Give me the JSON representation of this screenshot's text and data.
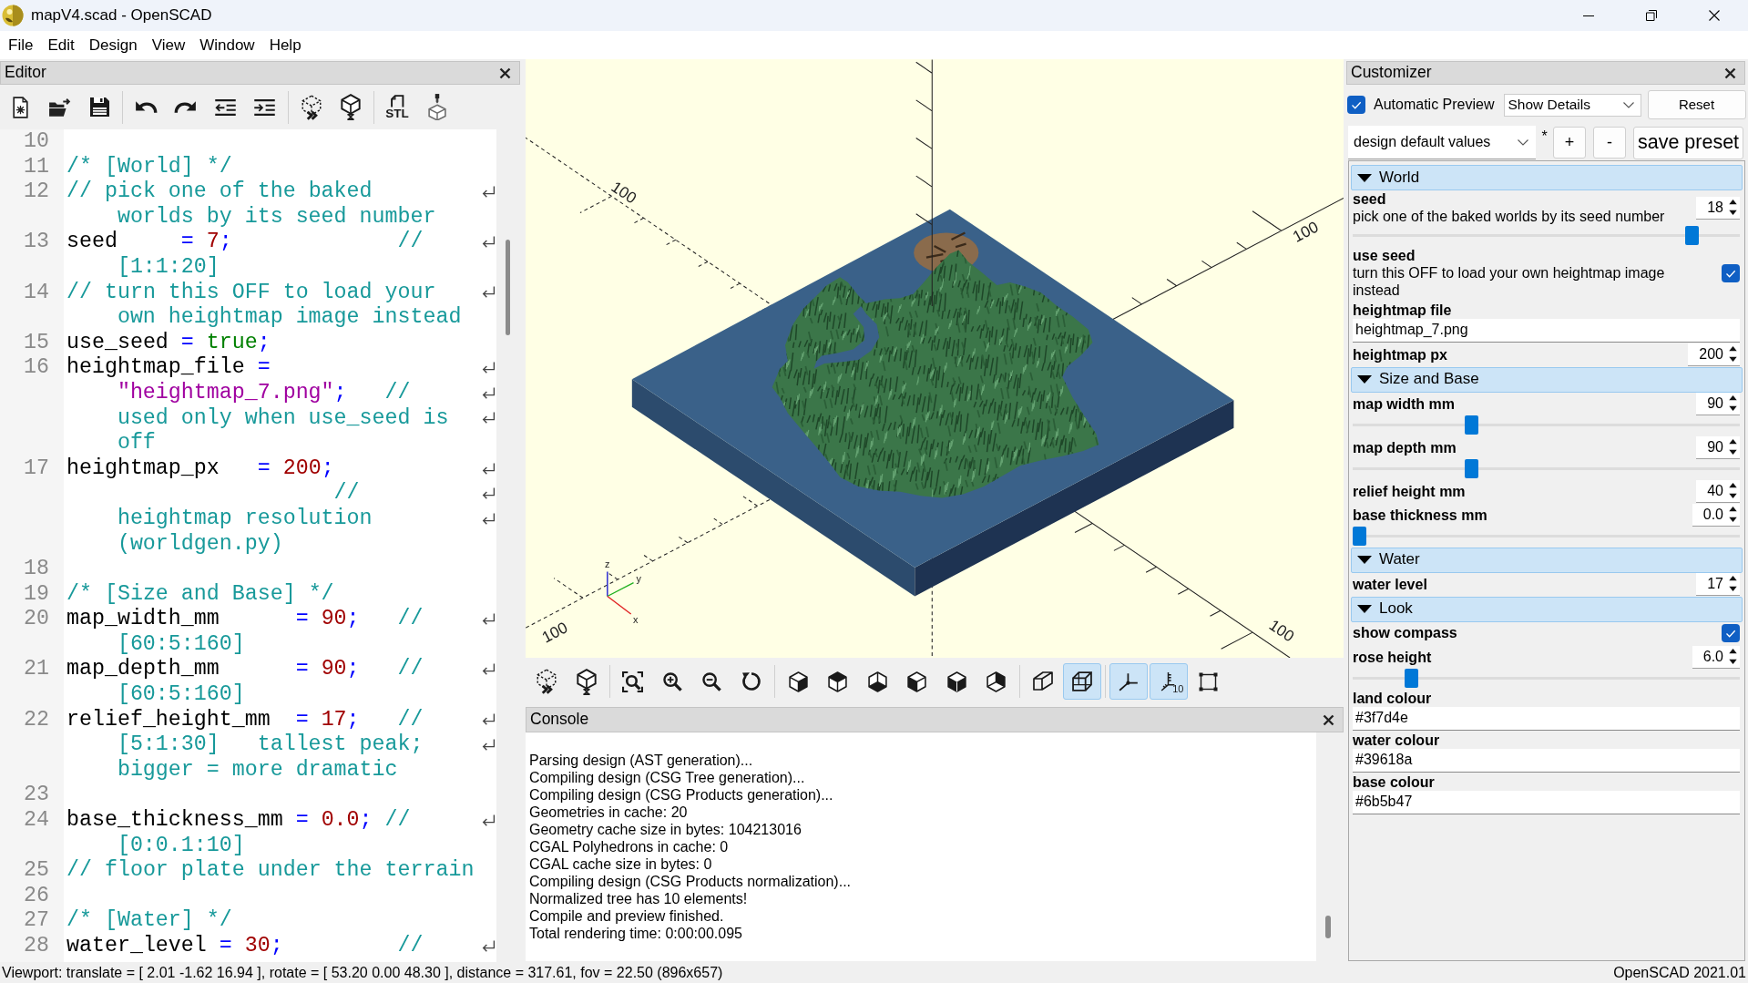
{
  "window": {
    "title": "mapV4.scad - OpenSCAD"
  },
  "menu": [
    "File",
    "Edit",
    "Design",
    "View",
    "Window",
    "Help"
  ],
  "editor": {
    "title": "Editor",
    "export_label": "STL",
    "lines": [
      {
        "number": "10"
      },
      {
        "number": "11",
        "display_lines": [
          {
            "spans": [
              {
                "kind": "comment",
                "text": "/* [World] */"
              }
            ]
          }
        ]
      },
      {
        "number": "12",
        "display_lines": [
          {
            "spans": [
              {
                "kind": "comment",
                "text": "// pick one of the baked"
              }
            ]
          },
          {
            "spans": [
              {
                "kind": "comment",
                "text": "worlds by its seed number"
              }
            ]
          }
        ]
      },
      {
        "number": "13",
        "display_lines": [
          {
            "spans": [
              {
                "kind": "name",
                "text": "seed     "
              },
              {
                "kind": "op",
                "text": "= "
              },
              {
                "kind": "number",
                "text": "7"
              },
              {
                "kind": "op",
                "text": ";"
              },
              {
                "kind": "comment",
                "text": "             //"
              }
            ]
          },
          {
            "spans": [
              {
                "kind": "comment",
                "text": "[1:1:20]"
              }
            ]
          }
        ]
      },
      {
        "number": "14",
        "display_lines": [
          {
            "spans": [
              {
                "kind": "comment",
                "text": "// turn this OFF to load your"
              }
            ]
          },
          {
            "spans": [
              {
                "kind": "comment",
                "text": "own heightmap image instead"
              }
            ]
          }
        ]
      },
      {
        "number": "15",
        "display_lines": [
          {
            "spans": [
              {
                "kind": "name",
                "text": "use_seed "
              },
              {
                "kind": "op",
                "text": "= "
              },
              {
                "kind": "keyword",
                "text": "true"
              },
              {
                "kind": "op",
                "text": ";"
              }
            ]
          }
        ]
      },
      {
        "number": "16",
        "display_lines": [
          {
            "spans": [
              {
                "kind": "name",
                "text": "heightmap_file "
              },
              {
                "kind": "op",
                "text": "="
              }
            ]
          },
          {
            "spans": [
              {
                "kind": "string",
                "text": "\"heightmap_7.png\""
              },
              {
                "kind": "op",
                "text": ";"
              },
              {
                "kind": "comment",
                "text": "   //"
              }
            ]
          },
          {
            "spans": [
              {
                "kind": "comment",
                "text": "used only when use_seed is"
              }
            ]
          },
          {
            "spans": [
              {
                "kind": "comment",
                "text": "off"
              }
            ]
          }
        ]
      },
      {
        "number": "17",
        "display_lines": [
          {
            "spans": [
              {
                "kind": "name",
                "text": "heightmap_px   "
              },
              {
                "kind": "op",
                "text": "= "
              },
              {
                "kind": "number",
                "text": "200"
              },
              {
                "kind": "op",
                "text": ";"
              }
            ]
          },
          {
            "spans": [
              {
                "kind": "comment",
                "text": "                 //"
              }
            ]
          },
          {
            "spans": [
              {
                "kind": "comment",
                "text": "heightmap resolution"
              }
            ]
          },
          {
            "spans": [
              {
                "kind": "comment",
                "text": "(worldgen.py)"
              }
            ]
          }
        ]
      },
      {
        "number": "18"
      },
      {
        "number": "19",
        "display_lines": [
          {
            "spans": [
              {
                "kind": "comment",
                "text": "/* [Size and Base] */"
              }
            ]
          }
        ]
      },
      {
        "number": "20",
        "display_lines": [
          {
            "spans": [
              {
                "kind": "name",
                "text": "map_width_mm      "
              },
              {
                "kind": "op",
                "text": "= "
              },
              {
                "kind": "number",
                "text": "90"
              },
              {
                "kind": "op",
                "text": ";"
              },
              {
                "kind": "comment",
                "text": "   //"
              }
            ]
          },
          {
            "spans": [
              {
                "kind": "comment",
                "text": "[60:5:160]"
              }
            ]
          }
        ]
      },
      {
        "number": "21",
        "display_lines": [
          {
            "spans": [
              {
                "kind": "name",
                "text": "map_depth_mm      "
              },
              {
                "kind": "op",
                "text": "= "
              },
              {
                "kind": "number",
                "text": "90"
              },
              {
                "kind": "op",
                "text": ";"
              },
              {
                "kind": "comment",
                "text": "   //"
              }
            ]
          },
          {
            "spans": [
              {
                "kind": "comment",
                "text": "[60:5:160]"
              }
            ]
          }
        ]
      },
      {
        "number": "22",
        "display_lines": [
          {
            "spans": [
              {
                "kind": "name",
                "text": "relief_height_mm  "
              },
              {
                "kind": "op",
                "text": "= "
              },
              {
                "kind": "number",
                "text": "17"
              },
              {
                "kind": "op",
                "text": ";"
              },
              {
                "kind": "comment",
                "text": "   //"
              }
            ]
          },
          {
            "spans": [
              {
                "kind": "comment",
                "text": "[5:1:30]   tallest peak;"
              }
            ]
          },
          {
            "spans": [
              {
                "kind": "comment",
                "text": "bigger = more dramatic"
              }
            ]
          }
        ]
      },
      {
        "number": "23"
      },
      {
        "number": "24",
        "display_lines": [
          {
            "spans": [
              {
                "kind": "name",
                "text": "base_thickness_mm "
              },
              {
                "kind": "op",
                "text": "= "
              },
              {
                "kind": "number",
                "text": "0.0"
              },
              {
                "kind": "op",
                "text": ";"
              },
              {
                "kind": "comment",
                "text": " //"
              }
            ]
          },
          {
            "spans": [
              {
                "kind": "comment",
                "text": "[0:0.1:10]"
              }
            ]
          }
        ]
      },
      {
        "number": "25",
        "display_lines": [
          {
            "spans": [
              {
                "kind": "comment",
                "text": "// floor plate under the terrain"
              }
            ]
          }
        ]
      },
      {
        "number": "26"
      },
      {
        "number": "27",
        "display_lines": [
          {
            "spans": [
              {
                "kind": "comment",
                "text": "/* [Water] */"
              }
            ]
          }
        ]
      },
      {
        "number": "28",
        "continues_below": true,
        "display_lines": [
          {
            "spans": [
              {
                "kind": "name",
                "text": "water_level "
              },
              {
                "kind": "op",
                "text": "= "
              },
              {
                "kind": "number",
                "text": "30"
              },
              {
                "kind": "op",
                "text": ";"
              },
              {
                "kind": "comment",
                "text": "         //"
              }
            ]
          }
        ]
      }
    ]
  },
  "viewport": {
    "scale_labels": [
      "100",
      "100",
      "100",
      "100"
    ],
    "axis_letters": [
      "z",
      "y",
      "x"
    ]
  },
  "view_toolbar": {
    "projection": [
      {
        "selected": false
      },
      {
        "selected": true
      }
    ],
    "toggles": [
      {
        "on": true
      },
      {
        "on": true,
        "label": "10"
      },
      {
        "on": false
      }
    ]
  },
  "console": {
    "title": "Console",
    "lines": [
      "Parsing design (AST generation)...",
      "Compiling design (CSG Tree generation)...",
      "Compiling design (CSG Products generation)...",
      "Geometries in cache: 20",
      "Geometry cache size in bytes: 104213016",
      "CGAL Polyhedrons in cache: 0",
      "CGAL cache size in bytes: 0",
      "Compiling design (CSG Products normalization)...",
      "Normalized tree has 10 elements!",
      "Compile and preview finished.",
      "Total rendering time: 0:00:00.095"
    ]
  },
  "customizer": {
    "title": "Customizer",
    "auto_preview": {
      "label": "Automatic Preview",
      "checked": true
    },
    "details_mode": "Show Details",
    "reset_label": "Reset",
    "preset": "design default values",
    "modified_mark": "*",
    "preset_buttons": [
      "+",
      "-",
      "save preset"
    ],
    "groups": [
      {
        "title": "World",
        "expanded": true,
        "params": [
          {
            "kind": "slider",
            "label": "seed",
            "description": "pick one of the baked worlds by its seed number",
            "value": "18",
            "level": 0.89
          },
          {
            "kind": "checkbox",
            "label": "use seed",
            "description": "turn this OFF to load your own heightmap image instead",
            "checked": true
          },
          {
            "kind": "text",
            "label": "heightmap file",
            "value": "heightmap_7.png"
          },
          {
            "kind": "spin",
            "label": "heightmap px",
            "value": "200"
          }
        ]
      },
      {
        "title": "Size and Base",
        "expanded": true,
        "params": [
          {
            "kind": "slider",
            "label": "map width mm",
            "value": "90",
            "level": 0.3
          },
          {
            "kind": "slider",
            "label": "map depth mm",
            "value": "90",
            "level": 0.3
          },
          {
            "kind": "spin",
            "label": "relief height mm",
            "value": "40"
          },
          {
            "kind": "slider",
            "label": "base thickness mm",
            "value": "0.0",
            "level": 0
          }
        ]
      },
      {
        "title": "Water",
        "expanded": true,
        "params": [
          {
            "kind": "spin",
            "label": "water level",
            "value": "17"
          }
        ]
      },
      {
        "title": "Look",
        "expanded": true,
        "params": [
          {
            "kind": "checkbox",
            "label": "show compass",
            "checked": true
          },
          {
            "kind": "slider",
            "label": "rose height",
            "value": "6.0",
            "level": 0.14
          },
          {
            "kind": "text",
            "label": "land colour",
            "value": "#3f7d4e"
          },
          {
            "kind": "text",
            "label": "water colour",
            "value": "#39618a"
          },
          {
            "kind": "text",
            "label": "base colour",
            "value": "#6b5b47"
          }
        ]
      }
    ]
  },
  "status_bar": {
    "viewport_info": "Viewport: translate = [ 2.01 -1.62 16.94 ], rotate = [ 53.20 0.00 48.30 ], distance = 317.61, fov = 22.50 (896x657)",
    "version": "OpenSCAD 2021.01"
  }
}
